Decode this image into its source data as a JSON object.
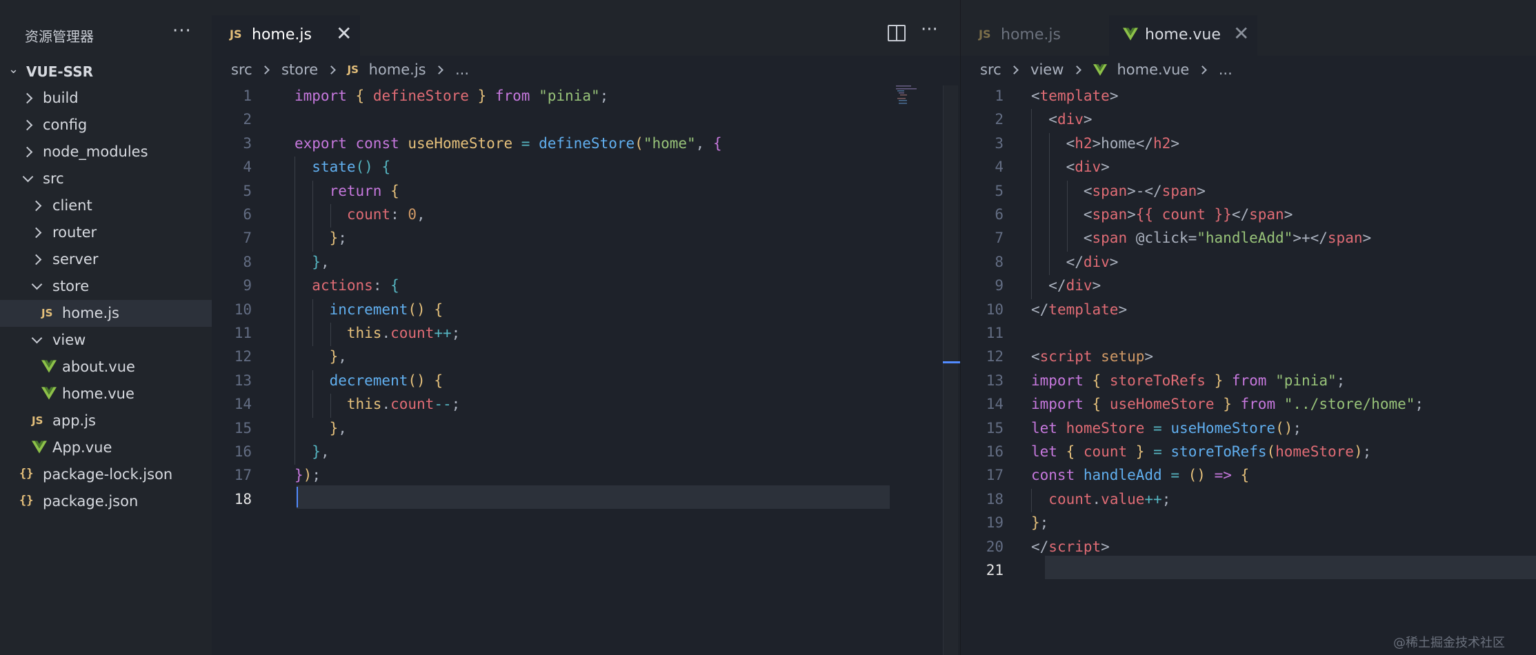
{
  "sidebar": {
    "title": "资源管理器",
    "more_label": "···",
    "project": "VUE-SSR",
    "items": [
      {
        "label": "build",
        "kind": "folder"
      },
      {
        "label": "config",
        "kind": "folder"
      },
      {
        "label": "node_modules",
        "kind": "folder"
      },
      {
        "label": "src",
        "kind": "folder-open"
      },
      {
        "label": "client",
        "kind": "folder"
      },
      {
        "label": "router",
        "kind": "folder"
      },
      {
        "label": "server",
        "kind": "folder"
      },
      {
        "label": "store",
        "kind": "folder-open"
      },
      {
        "label": "home.js",
        "kind": "js-file",
        "icon_text": "JS"
      },
      {
        "label": "view",
        "kind": "folder-open"
      },
      {
        "label": "about.vue",
        "kind": "vue-file"
      },
      {
        "label": "home.vue",
        "kind": "vue-file"
      },
      {
        "label": "app.js",
        "kind": "js-file",
        "icon_text": "JS"
      },
      {
        "label": "App.vue",
        "kind": "vue-file"
      },
      {
        "label": "package-lock.json",
        "kind": "json-file",
        "icon_text": "{}"
      },
      {
        "label": "package.json",
        "kind": "json-file",
        "icon_text": "{}"
      }
    ]
  },
  "left_editor": {
    "tab": {
      "icon_text": "JS",
      "label": "home.js",
      "close": "✕"
    },
    "more_label": "···",
    "breadcrumb": {
      "a": "src",
      "b": "store",
      "icon_text": "JS",
      "c": "home.js",
      "d": "..."
    },
    "line_numbers": [
      "1",
      "2",
      "3",
      "4",
      "5",
      "6",
      "7",
      "8",
      "9",
      "10",
      "11",
      "12",
      "13",
      "14",
      "15",
      "16",
      "17",
      "18"
    ],
    "current_line": "18"
  },
  "right_editor": {
    "inactive_tab": {
      "icon_text": "JS",
      "label": "home.js"
    },
    "active_tab": {
      "label": "home.vue",
      "close": "✕"
    },
    "breadcrumb": {
      "a": "src",
      "b": "view",
      "c": "home.vue",
      "d": "..."
    },
    "line_numbers": [
      "1",
      "2",
      "3",
      "4",
      "5",
      "6",
      "7",
      "8",
      "9",
      "10",
      "11",
      "12",
      "13",
      "14",
      "15",
      "16",
      "17",
      "18",
      "19",
      "20",
      "21"
    ],
    "current_line": "21"
  },
  "watermark": "@稀土掘金技术社区",
  "colors": {
    "keyword": "#c678dd",
    "function": "#61afef",
    "string": "#98c379",
    "number": "#d19a66",
    "property": "#e06c75",
    "tag": "#e06c75",
    "operator": "#56b6c2",
    "bracket_yellow": "#e5c07b",
    "cursor": "#528bff",
    "vue_green": "#8dc149"
  },
  "code_left": [
    [
      [
        "k",
        "import"
      ],
      [
        "p",
        " "
      ],
      [
        "b1",
        "{"
      ],
      [
        "p",
        " "
      ],
      [
        "v",
        "defineStore"
      ],
      [
        "p",
        " "
      ],
      [
        "b1",
        "}"
      ],
      [
        "p",
        " "
      ],
      [
        "k",
        "from"
      ],
      [
        "p",
        " "
      ],
      [
        "s",
        "\"pinia\""
      ],
      [
        "p",
        ";"
      ]
    ],
    [],
    [
      [
        "k",
        "export"
      ],
      [
        "p",
        " "
      ],
      [
        "k",
        "const"
      ],
      [
        "p",
        " "
      ],
      [
        "y",
        "useHomeStore"
      ],
      [
        "p",
        " "
      ],
      [
        "o",
        "="
      ],
      [
        "p",
        " "
      ],
      [
        "f",
        "defineStore"
      ],
      [
        "b1",
        "("
      ],
      [
        "s",
        "\"home\""
      ],
      [
        "p",
        ", "
      ],
      [
        "b2",
        "{"
      ]
    ],
    [
      [
        "p",
        "  "
      ],
      [
        "f",
        "state"
      ],
      [
        "b3",
        "()"
      ],
      [
        "p",
        " "
      ],
      [
        "b3",
        "{"
      ]
    ],
    [
      [
        "p",
        "    "
      ],
      [
        "k",
        "return"
      ],
      [
        "p",
        " "
      ],
      [
        "b1",
        "{"
      ]
    ],
    [
      [
        "p",
        "      "
      ],
      [
        "v",
        "count"
      ],
      [
        "p",
        ": "
      ],
      [
        "n",
        "0"
      ],
      [
        "p",
        ","
      ]
    ],
    [
      [
        "p",
        "    "
      ],
      [
        "b1",
        "}"
      ],
      [
        "p",
        ";"
      ]
    ],
    [
      [
        "p",
        "  "
      ],
      [
        "b3",
        "}"
      ],
      [
        "p",
        ","
      ]
    ],
    [
      [
        "p",
        "  "
      ],
      [
        "v",
        "actions"
      ],
      [
        "p",
        ": "
      ],
      [
        "b3",
        "{"
      ]
    ],
    [
      [
        "p",
        "    "
      ],
      [
        "f",
        "increment"
      ],
      [
        "b1",
        "()"
      ],
      [
        "p",
        " "
      ],
      [
        "b1",
        "{"
      ]
    ],
    [
      [
        "p",
        "      "
      ],
      [
        "y",
        "this"
      ],
      [
        "p",
        "."
      ],
      [
        "v",
        "count"
      ],
      [
        "o",
        "++"
      ],
      [
        "p",
        ";"
      ]
    ],
    [
      [
        "p",
        "    "
      ],
      [
        "b1",
        "}"
      ],
      [
        "p",
        ","
      ]
    ],
    [
      [
        "p",
        "    "
      ],
      [
        "f",
        "decrement"
      ],
      [
        "b1",
        "()"
      ],
      [
        "p",
        " "
      ],
      [
        "b1",
        "{"
      ]
    ],
    [
      [
        "p",
        "      "
      ],
      [
        "y",
        "this"
      ],
      [
        "p",
        "."
      ],
      [
        "v",
        "count"
      ],
      [
        "o",
        "--"
      ],
      [
        "p",
        ";"
      ]
    ],
    [
      [
        "p",
        "    "
      ],
      [
        "b1",
        "}"
      ],
      [
        "p",
        ","
      ]
    ],
    [
      [
        "p",
        "  "
      ],
      [
        "b3",
        "}"
      ],
      [
        "p",
        ","
      ]
    ],
    [
      [
        "b2",
        "}"
      ],
      [
        "b1",
        ")"
      ],
      [
        "p",
        ";"
      ]
    ],
    []
  ],
  "code_right": [
    [
      [
        "p",
        "<"
      ],
      [
        "t",
        "template"
      ],
      [
        "p",
        ">"
      ]
    ],
    [
      [
        "p",
        "  <"
      ],
      [
        "t",
        "div"
      ],
      [
        "p",
        ">"
      ]
    ],
    [
      [
        "p",
        "    <"
      ],
      [
        "t",
        "h2"
      ],
      [
        "p",
        ">home</"
      ],
      [
        "t",
        "h2"
      ],
      [
        "p",
        ">"
      ]
    ],
    [
      [
        "p",
        "    <"
      ],
      [
        "t",
        "div"
      ],
      [
        "p",
        ">"
      ]
    ],
    [
      [
        "p",
        "      <"
      ],
      [
        "t",
        "span"
      ],
      [
        "p",
        ">-</"
      ],
      [
        "t",
        "span"
      ],
      [
        "p",
        ">"
      ]
    ],
    [
      [
        "p",
        "      <"
      ],
      [
        "t",
        "span"
      ],
      [
        "p",
        ">"
      ],
      [
        "v",
        "{{ count }}"
      ],
      [
        "p",
        "</"
      ],
      [
        "t",
        "span"
      ],
      [
        "p",
        ">"
      ]
    ],
    [
      [
        "p",
        "      <"
      ],
      [
        "t",
        "span"
      ],
      [
        "p",
        " @click="
      ],
      [
        "s",
        "\"handleAdd\""
      ],
      [
        "p",
        ">+</"
      ],
      [
        "t",
        "span"
      ],
      [
        "p",
        ">"
      ]
    ],
    [
      [
        "p",
        "    </"
      ],
      [
        "t",
        "div"
      ],
      [
        "p",
        ">"
      ]
    ],
    [
      [
        "p",
        "  </"
      ],
      [
        "t",
        "div"
      ],
      [
        "p",
        ">"
      ]
    ],
    [
      [
        "p",
        "</"
      ],
      [
        "t",
        "template"
      ],
      [
        "p",
        ">"
      ]
    ],
    [],
    [
      [
        "p",
        "<"
      ],
      [
        "t",
        "script"
      ],
      [
        "p",
        " "
      ],
      [
        "n",
        "setup"
      ],
      [
        "p",
        ">"
      ]
    ],
    [
      [
        "k",
        "import"
      ],
      [
        "p",
        " "
      ],
      [
        "b1",
        "{"
      ],
      [
        "p",
        " "
      ],
      [
        "v",
        "storeToRefs"
      ],
      [
        "p",
        " "
      ],
      [
        "b1",
        "}"
      ],
      [
        "p",
        " "
      ],
      [
        "k",
        "from"
      ],
      [
        "p",
        " "
      ],
      [
        "s",
        "\"pinia\""
      ],
      [
        "p",
        ";"
      ]
    ],
    [
      [
        "k",
        "import"
      ],
      [
        "p",
        " "
      ],
      [
        "b1",
        "{"
      ],
      [
        "p",
        " "
      ],
      [
        "v",
        "useHomeStore"
      ],
      [
        "p",
        " "
      ],
      [
        "b1",
        "}"
      ],
      [
        "p",
        " "
      ],
      [
        "k",
        "from"
      ],
      [
        "p",
        " "
      ],
      [
        "s",
        "\"../store/home\""
      ],
      [
        "p",
        ";"
      ]
    ],
    [
      [
        "k",
        "let"
      ],
      [
        "p",
        " "
      ],
      [
        "v",
        "homeStore"
      ],
      [
        "p",
        " "
      ],
      [
        "o",
        "="
      ],
      [
        "p",
        " "
      ],
      [
        "f",
        "useHomeStore"
      ],
      [
        "b1",
        "()"
      ],
      [
        "p",
        ";"
      ]
    ],
    [
      [
        "k",
        "let"
      ],
      [
        "p",
        " "
      ],
      [
        "b1",
        "{"
      ],
      [
        "p",
        " "
      ],
      [
        "v",
        "count"
      ],
      [
        "p",
        " "
      ],
      [
        "b1",
        "}"
      ],
      [
        "p",
        " "
      ],
      [
        "o",
        "="
      ],
      [
        "p",
        " "
      ],
      [
        "f",
        "storeToRefs"
      ],
      [
        "b1",
        "("
      ],
      [
        "v",
        "homeStore"
      ],
      [
        "b1",
        ")"
      ],
      [
        "p",
        ";"
      ]
    ],
    [
      [
        "k",
        "const"
      ],
      [
        "p",
        " "
      ],
      [
        "f",
        "handleAdd"
      ],
      [
        "p",
        " "
      ],
      [
        "o",
        "="
      ],
      [
        "p",
        " "
      ],
      [
        "b1",
        "()"
      ],
      [
        "p",
        " "
      ],
      [
        "k",
        "=>"
      ],
      [
        "p",
        " "
      ],
      [
        "b1",
        "{"
      ]
    ],
    [
      [
        "p",
        "  "
      ],
      [
        "v",
        "count"
      ],
      [
        "p",
        "."
      ],
      [
        "v",
        "value"
      ],
      [
        "o",
        "++"
      ],
      [
        "p",
        ";"
      ]
    ],
    [
      [
        "b1",
        "}"
      ],
      [
        "p",
        ";"
      ]
    ],
    [
      [
        "p",
        "</"
      ],
      [
        "t",
        "script"
      ],
      [
        "p",
        ">"
      ]
    ],
    []
  ]
}
